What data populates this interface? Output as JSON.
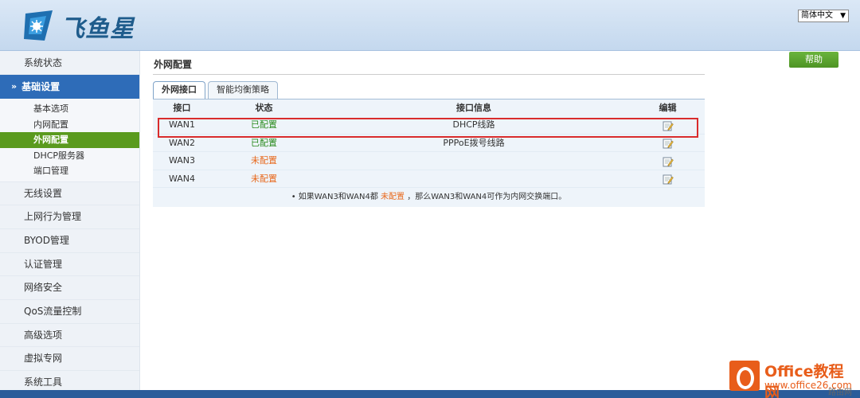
{
  "header": {
    "logo_text": "飞鱼星",
    "language": "简体中文",
    "colors": {
      "header_bg": "#c4d8ee",
      "brand": "#1f5c8c"
    }
  },
  "sidebar": {
    "items_top": [
      {
        "label": "系统状态"
      }
    ],
    "group": {
      "label": "基础设置",
      "icon": "double-chevron-down-icon"
    },
    "sub_items": [
      {
        "label": "基本选项",
        "active": false
      },
      {
        "label": "内网配置",
        "active": false
      },
      {
        "label": "外网配置",
        "active": true
      },
      {
        "label": "DHCP服务器",
        "active": false
      },
      {
        "label": "端口管理",
        "active": false
      }
    ],
    "items_bottom": [
      {
        "label": "无线设置"
      },
      {
        "label": "上网行为管理"
      },
      {
        "label": "BYOD管理"
      },
      {
        "label": "认证管理"
      },
      {
        "label": "网络安全"
      },
      {
        "label": "QoS流量控制"
      },
      {
        "label": "高级选项"
      },
      {
        "label": "虚拟专网"
      },
      {
        "label": "系统工具"
      }
    ]
  },
  "main": {
    "title": "外网配置",
    "help_label": "帮助",
    "tabs": [
      {
        "label": "外网接口",
        "active": true
      },
      {
        "label": "智能均衡策略",
        "active": false
      }
    ],
    "table": {
      "headers": [
        "接口",
        "状态",
        "接口信息",
        "编辑"
      ],
      "rows": [
        {
          "iface": "WAN1",
          "status": "已配置",
          "status_type": "ok",
          "info": "DHCP线路"
        },
        {
          "iface": "WAN2",
          "status": "已配置",
          "status_type": "ok",
          "info": "PPPoE拨号线路"
        },
        {
          "iface": "WAN3",
          "status": "未配置",
          "status_type": "no",
          "info": ""
        },
        {
          "iface": "WAN4",
          "status": "未配置",
          "status_type": "no",
          "info": ""
        }
      ],
      "note_prefix": "• 如果WAN3和WAN4都",
      "note_highlight": "未配置",
      "note_suffix": "，那么WAN3和WAN4可作为内网交换端口。"
    }
  },
  "watermark": {
    "title": "Office教程网",
    "url": "www.office26.com",
    "tag": "路由网"
  }
}
